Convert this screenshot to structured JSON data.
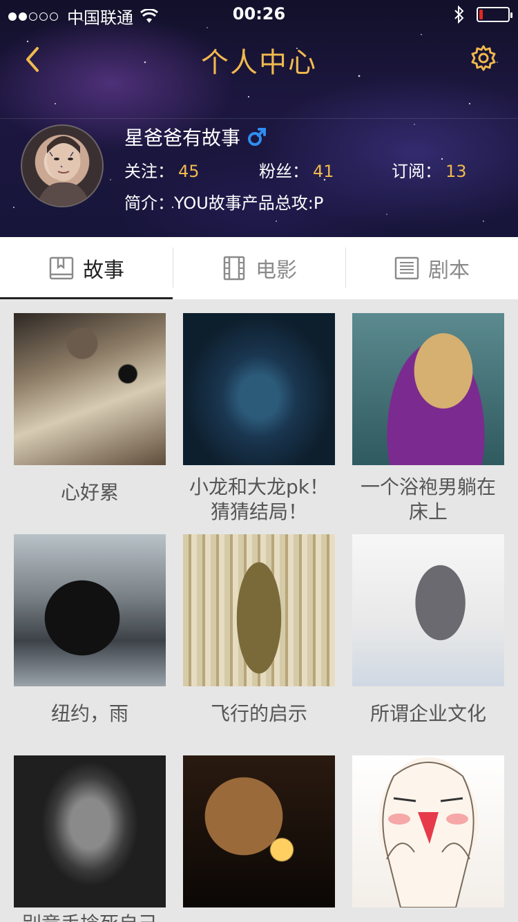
{
  "status_bar": {
    "carrier": "中国联通",
    "time": "00:26",
    "signal_dots_filled": 2,
    "signal_dots_total": 5,
    "battery_level": 0.12
  },
  "nav": {
    "title": "个人中心",
    "back_icon": "chevron-left-icon",
    "settings_icon": "gear-icon"
  },
  "profile": {
    "username": "星爸爸有故事",
    "gender_icon": "male-icon",
    "stats": [
      {
        "label": "关注：",
        "value": "45"
      },
      {
        "label": "粉丝：",
        "value": "41"
      },
      {
        "label": "订阅：",
        "value": "13"
      }
    ],
    "bio_label": "简介：",
    "bio": "YOU故事产品总攻:P"
  },
  "tabs": [
    {
      "label": "故事",
      "icon": "book-icon",
      "active": true
    },
    {
      "label": "电影",
      "icon": "film-icon",
      "active": false
    },
    {
      "label": "剧本",
      "icon": "script-icon",
      "active": false
    }
  ],
  "stories": [
    {
      "title": "心好累"
    },
    {
      "title": "小龙和大龙pk！猜猜结局！"
    },
    {
      "title": "一个浴袍男躺在床上"
    },
    {
      "title": "纽约，雨"
    },
    {
      "title": "飞行的启示"
    },
    {
      "title": "所谓企业文化"
    },
    {
      "title": "别竟手捻死自己"
    },
    {
      "title": ""
    },
    {
      "title": ""
    }
  ],
  "colors": {
    "accent": "#f1b94e",
    "gender_blue": "#2f8ef0",
    "battery_low": "#e2271f"
  }
}
